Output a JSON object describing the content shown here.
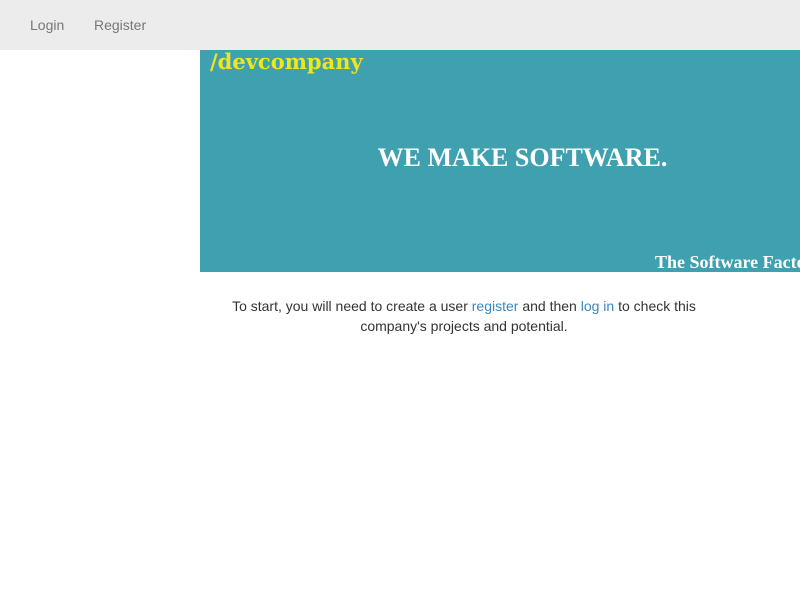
{
  "navbar": {
    "login_label": "Login",
    "register_label": "Register"
  },
  "banner": {
    "logo_text": "/devcompany",
    "headline": "WE MAKE SOFTWARE.",
    "tagline": "The Software Factory",
    "background_color": "#3fa0b0",
    "logo_color": "#f2e51a"
  },
  "intro": {
    "text_before_register": "To start, you will need to create a user ",
    "register_link": "register",
    "text_between": " and then ",
    "login_link": "log in",
    "text_after": " to check this company's projects and potential."
  }
}
